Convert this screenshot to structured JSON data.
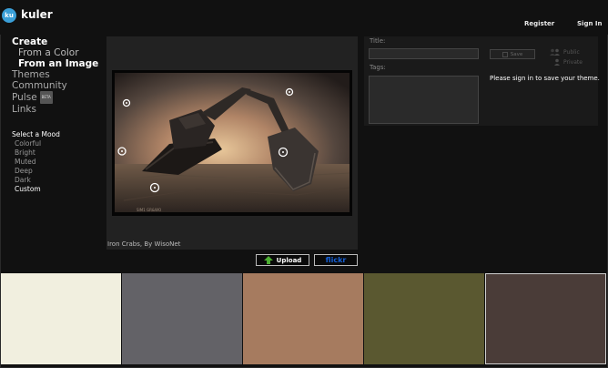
{
  "header": {
    "logo_badge": "ku",
    "app_name": "kuler",
    "register_label": "Register",
    "signin_label": "Sign In"
  },
  "nav": {
    "create_label": "Create",
    "from_color_label": "From a Color",
    "from_image_label": "From an Image",
    "themes_label": "Themes",
    "community_label": "Community",
    "pulse_label": "Pulse",
    "pulse_badge": "BETA",
    "links_label": "Links"
  },
  "mood": {
    "title": "Select a Mood",
    "items": [
      "Colorful",
      "Bright",
      "Muted",
      "Deep",
      "Dark",
      "Custom"
    ],
    "selected": "Custom"
  },
  "image": {
    "caption": "Iron Crabs, By WisoNet",
    "watermark": "SIM1 GR&WO"
  },
  "buttons": {
    "upload_label": "Upload",
    "flickr_label": "flickr"
  },
  "form": {
    "title_label": "Title:",
    "tags_label": "Tags:",
    "title_value": "",
    "tags_value": "",
    "save_label": "Save",
    "public_label": "Public",
    "private_label": "Private",
    "signin_message": "Please sign in to save your theme."
  },
  "palette": {
    "colors": [
      "#f1efdf",
      "#636267",
      "#a67b5f",
      "#5a5830",
      "#4a3c38"
    ],
    "selected_index": 4
  }
}
